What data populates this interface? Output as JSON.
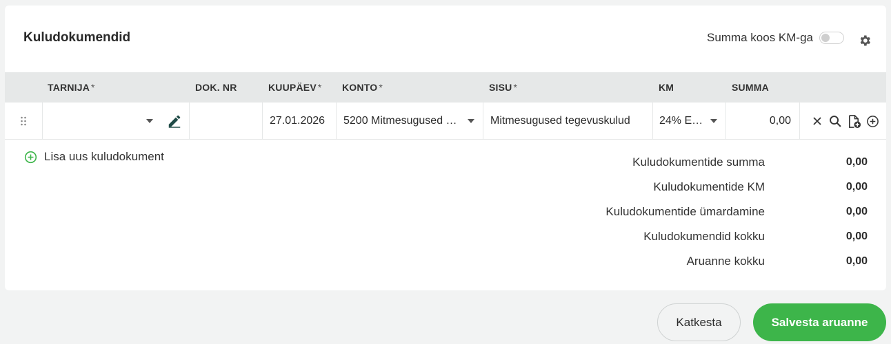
{
  "card": {
    "title": "Kuludokumendid",
    "vat_toggle_label": "Summa koos KM-ga"
  },
  "table": {
    "columns": [
      {
        "label": "TARNIJA",
        "required": "*"
      },
      {
        "label": "DOK. NR",
        "required": ""
      },
      {
        "label": "KUUPÄEV",
        "required": "*"
      },
      {
        "label": "KONTO",
        "required": "*"
      },
      {
        "label": "SISU",
        "required": "*"
      },
      {
        "label": "KM",
        "required": ""
      },
      {
        "label": "SUMMA",
        "required": ""
      }
    ],
    "row": {
      "supplier": "",
      "doc_nr": "",
      "date": "27.01.2026",
      "account": "5200 Mitmesugused …",
      "content": "Mitmesugused tegevuskulud",
      "vat": "24% E…",
      "amount": "0,00"
    }
  },
  "add_row_label": "Lisa uus kuludokument",
  "totals": [
    {
      "label": "Kuludokumentide summa",
      "value": "0,00"
    },
    {
      "label": "Kuludokumentide KM",
      "value": "0,00"
    },
    {
      "label": "Kuludokumentide ümardamine",
      "value": "0,00"
    },
    {
      "label": "Kuludokumendid kokku",
      "value": "0,00"
    },
    {
      "label": "Aruanne kokku",
      "value": "0,00"
    }
  ],
  "buttons": {
    "cancel": "Katkesta",
    "save": "Salvesta aruanne"
  },
  "colors": {
    "accent": "#3db54a",
    "header_bg": "#e6e8e8",
    "page_bg": "#f2f3f3"
  }
}
